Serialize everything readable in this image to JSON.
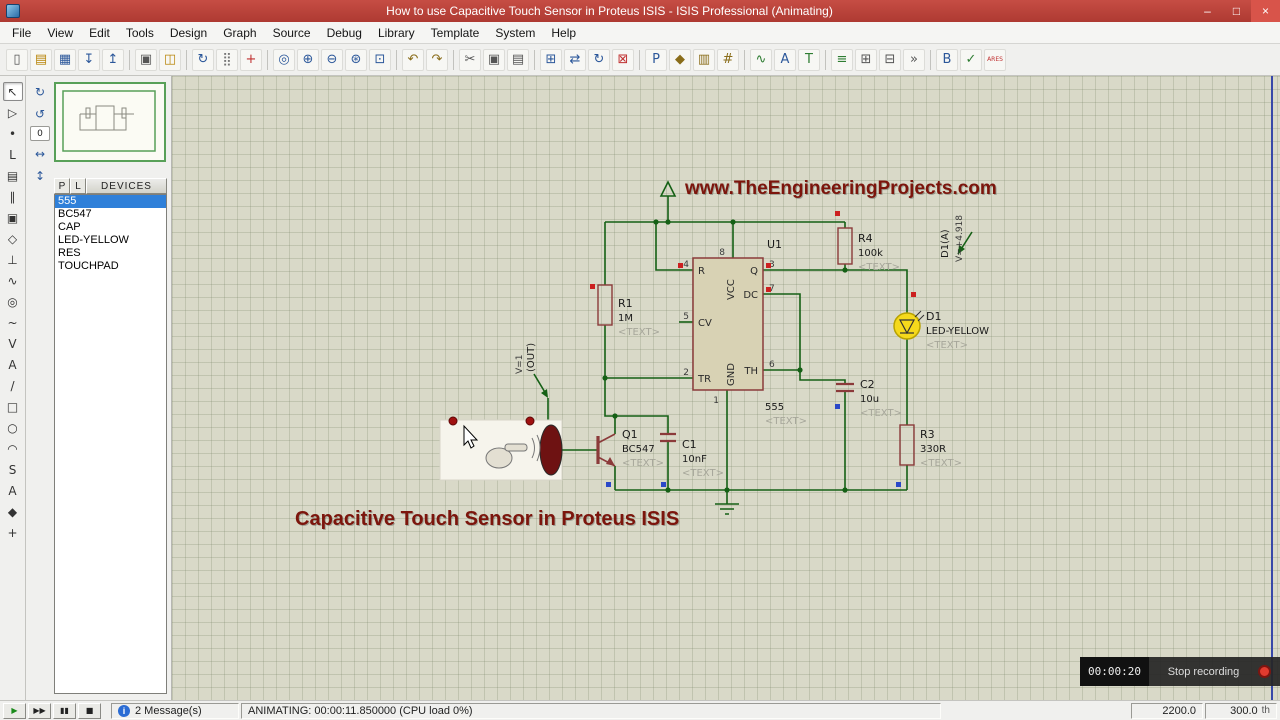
{
  "window": {
    "title": "How to use Capacitive Touch Sensor in Proteus ISIS - ISIS Professional (Animating)",
    "controls": {
      "minimize": "–",
      "maximize": "□",
      "close": "×"
    }
  },
  "menu_bar": {
    "items": [
      "File",
      "View",
      "Edit",
      "Tools",
      "Design",
      "Graph",
      "Source",
      "Debug",
      "Library",
      "Template",
      "System",
      "Help"
    ]
  },
  "toolbar": {
    "icons": [
      {
        "name": "new-design",
        "glyph": "▯",
        "color": "#555"
      },
      {
        "name": "open-design",
        "glyph": "▤",
        "color": "#b8860b"
      },
      {
        "name": "save-design",
        "glyph": "▦",
        "color": "#2b579a"
      },
      {
        "name": "import-section",
        "glyph": "↧",
        "color": "#2b579a"
      },
      {
        "name": "export-section",
        "glyph": "↥",
        "color": "#2b579a"
      },
      {
        "sep": true
      },
      {
        "name": "print-design",
        "glyph": "▣",
        "color": "#555"
      },
      {
        "name": "mark-output-area",
        "glyph": "◫",
        "color": "#b8860b"
      },
      {
        "sep": true
      },
      {
        "name": "refresh-display",
        "glyph": "↻",
        "color": "#2b579a"
      },
      {
        "name": "toggle-grid",
        "glyph": "⣿",
        "color": "#777"
      },
      {
        "name": "toggle-origin",
        "glyph": "+",
        "color": "#c03030"
      },
      {
        "sep": true
      },
      {
        "name": "center-at-cursor",
        "glyph": "◎",
        "color": "#2b579a"
      },
      {
        "name": "zoom-in",
        "glyph": "⊕",
        "color": "#2b579a"
      },
      {
        "name": "zoom-out",
        "glyph": "⊖",
        "color": "#2b579a"
      },
      {
        "name": "zoom-all",
        "glyph": "⊛",
        "color": "#2b579a"
      },
      {
        "name": "zoom-area",
        "glyph": "⊡",
        "color": "#2b579a"
      },
      {
        "sep": true
      },
      {
        "name": "undo",
        "glyph": "↶",
        "color": "#8a6d1a"
      },
      {
        "name": "redo",
        "glyph": "↷",
        "color": "#8a6d1a"
      },
      {
        "sep": true
      },
      {
        "name": "cut",
        "glyph": "✂",
        "color": "#555"
      },
      {
        "name": "copy",
        "glyph": "▣",
        "color": "#555"
      },
      {
        "name": "paste",
        "glyph": "▤",
        "color": "#555"
      },
      {
        "sep": true
      },
      {
        "name": "block-copy",
        "glyph": "⊞",
        "color": "#2b579a"
      },
      {
        "name": "block-move",
        "glyph": "⇄",
        "color": "#2b579a"
      },
      {
        "name": "block-rotate",
        "glyph": "↻",
        "color": "#2b579a"
      },
      {
        "name": "block-delete",
        "glyph": "⊠",
        "color": "#c03030"
      },
      {
        "sep": true
      },
      {
        "name": "pick-parts",
        "glyph": "P",
        "color": "#2b579a"
      },
      {
        "name": "make-device",
        "glyph": "◆",
        "color": "#8a6d1a"
      },
      {
        "name": "packaging-tool",
        "glyph": "▥",
        "color": "#8a6d1a"
      },
      {
        "name": "decompose",
        "glyph": "#",
        "color": "#8a6d1a"
      },
      {
        "sep": true
      },
      {
        "name": "wire-autorouter",
        "glyph": "∿",
        "color": "#2e7d32"
      },
      {
        "name": "search-and-tag",
        "glyph": "A",
        "color": "#2b579a"
      },
      {
        "name": "property-assignment",
        "glyph": "T",
        "color": "#2e7d32"
      },
      {
        "sep": true
      },
      {
        "name": "design-explorer",
        "glyph": "≡",
        "color": "#2e7d32"
      },
      {
        "name": "new-sheet",
        "glyph": "⊞",
        "color": "#555"
      },
      {
        "name": "remove-sheet",
        "glyph": "⊟",
        "color": "#555"
      },
      {
        "name": "goto-sheet",
        "glyph": "»",
        "color": "#555"
      },
      {
        "sep": true
      },
      {
        "name": "bill-of-materials",
        "glyph": "B",
        "color": "#2b579a"
      },
      {
        "name": "electrical-rule-check",
        "glyph": "✓",
        "color": "#2e7d32"
      },
      {
        "name": "netlist-to-ares",
        "glyph": "ARES",
        "color": "#c03030"
      }
    ]
  },
  "mode_toolbar": {
    "icons": [
      {
        "name": "selection-mode",
        "glyph": "↖",
        "selected": true
      },
      {
        "name": "component-mode",
        "glyph": "▷"
      },
      {
        "name": "junction-dot-mode",
        "glyph": "•"
      },
      {
        "name": "wire-label-mode",
        "glyph": "L"
      },
      {
        "name": "text-script-mode",
        "glyph": "▤"
      },
      {
        "name": "buses-mode",
        "glyph": "∥"
      },
      {
        "name": "subcircuit-mode",
        "glyph": "▣"
      },
      {
        "name": "terminals-mode",
        "glyph": "◇"
      },
      {
        "name": "device-pins-mode",
        "glyph": "⊥"
      },
      {
        "name": "graph-mode",
        "glyph": "∿"
      },
      {
        "name": "tape-recorder-mode",
        "glyph": "◎"
      },
      {
        "name": "generator-mode",
        "glyph": "~"
      },
      {
        "name": "voltage-probe-mode",
        "glyph": "V"
      },
      {
        "name": "current-probe-mode",
        "glyph": "A"
      },
      {
        "name": "2d-line-mode",
        "glyph": "/"
      },
      {
        "name": "2d-box-mode",
        "glyph": "□"
      },
      {
        "name": "2d-circle-mode",
        "glyph": "○"
      },
      {
        "name": "2d-arc-mode",
        "glyph": "◠"
      },
      {
        "name": "2d-path-mode",
        "glyph": "S"
      },
      {
        "name": "2d-text-mode",
        "glyph": "A"
      },
      {
        "name": "2d-symbol-mode",
        "glyph": "◆"
      },
      {
        "name": "marker-mode",
        "glyph": "+"
      }
    ]
  },
  "orientation": {
    "buttons": [
      {
        "name": "rotate-clockwise",
        "glyph": "↻"
      },
      {
        "name": "rotate-anticlockwise",
        "glyph": "↺"
      },
      {
        "name": "angle-display",
        "glyph": "0",
        "readout": true
      },
      {
        "name": "mirror-horizontal",
        "glyph": "↔"
      },
      {
        "name": "mirror-vertical",
        "glyph": "↕"
      }
    ]
  },
  "devices_panel": {
    "pick_label": "P",
    "library_label": "L",
    "header": "DEVICES",
    "items": [
      {
        "label": "555",
        "selected": true
      },
      {
        "label": "BC547"
      },
      {
        "label": "CAP"
      },
      {
        "label": "LED-YELLOW"
      },
      {
        "label": "RES"
      },
      {
        "label": "TOUCHPAD"
      }
    ]
  },
  "schematic": {
    "watermark": "www.TheEngineeringProjects.com",
    "caption": "Capacitive Touch Sensor in Proteus ISIS",
    "components": {
      "u1": {
        "ref": "U1",
        "value": "555",
        "text": "<TEXT>"
      },
      "r1": {
        "ref": "R1",
        "value": "1M",
        "text": "<TEXT>"
      },
      "r4": {
        "ref": "R4",
        "value": "100k",
        "text": "<TEXT>"
      },
      "r3": {
        "ref": "R3",
        "value": "330R",
        "text": "<TEXT>"
      },
      "c1": {
        "ref": "C1",
        "value": "10nF",
        "text": "<TEXT>"
      },
      "c2": {
        "ref": "C2",
        "value": "10u",
        "text": "<TEXT>"
      },
      "q1": {
        "ref": "Q1",
        "value": "BC547",
        "text": "<TEXT>"
      },
      "d1": {
        "ref": "D1",
        "value": "LED-YELLOW",
        "text": "<TEXT>"
      }
    },
    "u1_pins": {
      "p4": "4",
      "p5": "5",
      "p2": "2",
      "p3": "3",
      "p7": "7",
      "p6": "6",
      "p8": "8",
      "p1": "1",
      "r": "R",
      "cv": "CV",
      "tr": "TR",
      "q": "Q",
      "dc": "DC",
      "th": "TH",
      "vcc": "VCC",
      "gnd": "GND"
    },
    "probe_out": {
      "name": "(OUT)",
      "value": "V=1"
    },
    "probe_d1": {
      "name": "D1(A)",
      "value": "V=+4.918"
    }
  },
  "playback": {
    "buttons": [
      {
        "name": "play",
        "glyph": "▶",
        "color": "#1a8a1a"
      },
      {
        "name": "step",
        "glyph": "▶▶",
        "color": "#222"
      },
      {
        "name": "pause",
        "glyph": "▮▮",
        "color": "#222"
      },
      {
        "name": "stop",
        "glyph": "■",
        "color": "#222"
      }
    ]
  },
  "status_bar": {
    "info_glyph": "i",
    "messages": "2 Message(s)",
    "status": "ANIMATING: 00:00:11.850000 (CPU load 0%)",
    "coord_x": "2200.0",
    "coord_y": "300.0",
    "units": "th"
  },
  "recording": {
    "time": "00:00:20",
    "label": "Stop recording"
  }
}
